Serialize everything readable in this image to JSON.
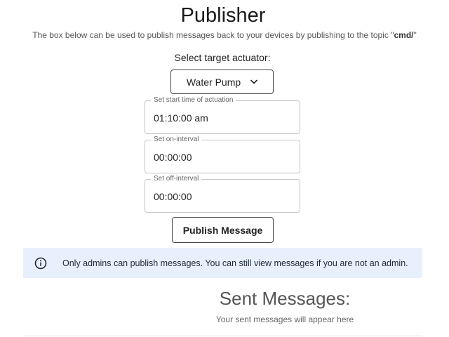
{
  "header": {
    "title": "Publisher",
    "description_prefix": "The box below can be used to publish messages back to your devices by publishing to the topic \"",
    "topic": "cmd/",
    "description_suffix": "\""
  },
  "actuator": {
    "label": "Select target actuator:",
    "selected": "Water Pump"
  },
  "fields": {
    "start_time": {
      "legend": "Set start time of actuation",
      "value": "01:10:00 am"
    },
    "on_interval": {
      "legend": "Set on-interval",
      "value": "00:00:00"
    },
    "off_interval": {
      "legend": "Set off-interval",
      "value": "00:00:00"
    }
  },
  "publish_button": {
    "label": "Publish Message"
  },
  "alert": {
    "icon": "info-icon",
    "text": "Only admins can publish messages. You can still view messages if you are not an admin.",
    "background": "#e8f0fe"
  },
  "sent": {
    "title": "Sent Messages:",
    "empty_text": "Your sent messages will appear here"
  }
}
